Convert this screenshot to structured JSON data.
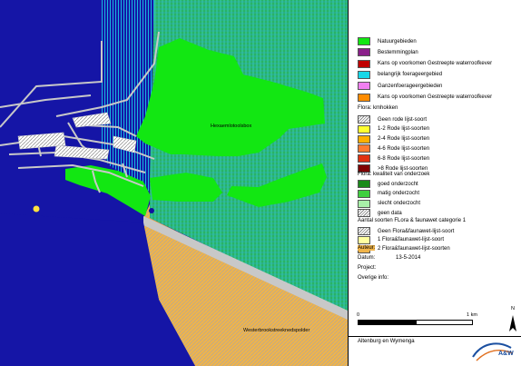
{
  "map": {
    "place_label_north": "Hexaemlotoolsbox",
    "place_label_south": "Westerbrookstreeknedspolder",
    "colors": {
      "sea": "#1515a6",
      "nature_green": "#12e712",
      "hatch_orange": "#f0b44a",
      "road": "#c8c8c8",
      "water_dot": "#ffe040"
    }
  },
  "legend": {
    "items_top": [
      {
        "label": "Natuurgebieden",
        "color": "#12e712",
        "pattern": "solid"
      },
      {
        "label": "Bestemmingplan",
        "color": "#8a208a",
        "pattern": "solid"
      },
      {
        "label": "Kans op voorkomen Gestreepte waterroofkever",
        "color": "#c00000",
        "pattern": "solid"
      },
      {
        "label": "belangrijk foerageergebied",
        "color": "#18d8e8",
        "pattern": "solid"
      },
      {
        "label": "Ganzenfoerageergebieden",
        "color": "#f080f0",
        "pattern": "solid"
      },
      {
        "label": "Kans op voorkomen Gestreepte waterroofkever",
        "color": "#ff8c00",
        "pattern": "solid"
      }
    ],
    "flora_km_header": "Flora: kmhokken",
    "flora_km": [
      {
        "label": "Geen rode lijst-soort",
        "color": "#d8d8d8",
        "pattern": "hatch"
      },
      {
        "label": "1-2 Rode lijst-soorten",
        "color": "#ffff30",
        "pattern": "solid"
      },
      {
        "label": "2-4 Rode lijst-soorten",
        "color": "#ffb000",
        "pattern": "solid"
      },
      {
        "label": "4-6 Rode lijst-soorten",
        "color": "#ff7a30",
        "pattern": "solid"
      },
      {
        "label": "6-8 Rode lijst-soorten",
        "color": "#e03010",
        "pattern": "solid"
      },
      {
        "label": ">8 Rode lijst-soorten",
        "color": "#800000",
        "pattern": "solid"
      }
    ],
    "flora_quality_header": "Flora: kwaliteit van onderzoek",
    "flora_quality": [
      {
        "label": "goed onderzocht",
        "color": "#1a8a1a",
        "pattern": "solid"
      },
      {
        "label": "matig onderzocht",
        "color": "#3fcf3f",
        "pattern": "solid"
      },
      {
        "label": "slecht onderzocht",
        "color": "#a8f0a8",
        "pattern": "solid"
      },
      {
        "label": "geen data",
        "color": "#d0d0d0",
        "pattern": "hatch"
      }
    ],
    "fauna_header": "Aantal soorten FLora & faunawet categorie 1",
    "fauna": [
      {
        "label": "Geen Flora&faunawet-lijst-soort",
        "color": "#d8d8d8",
        "pattern": "hatch"
      },
      {
        "label": "1 Flora&faunawet-lijst-soort",
        "color": "#ffffa0",
        "pattern": "solid"
      },
      {
        "label": "2 Flora&faunawet-lijst-soorten",
        "color": "#f0b44a",
        "pattern": "solid"
      }
    ],
    "auteur_label": "Auteur:",
    "datum_label": "Datum:",
    "datum_value": "13-5-2014",
    "project_label": "Project:",
    "overige_label": "Overige info:"
  },
  "scalebar": {
    "start": "0",
    "end": "1 km"
  },
  "north_arrow": "N",
  "footer": {
    "company": "Altenburg en Wymenga",
    "logo_text": "A&W"
  }
}
